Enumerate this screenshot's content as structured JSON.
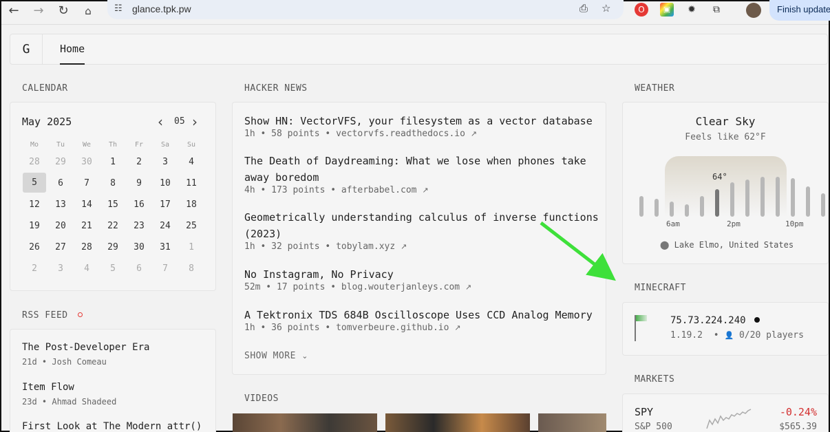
{
  "browser": {
    "url": "glance.tpk.pw",
    "finish_update_label": "Finish update"
  },
  "header": {
    "logo": "G",
    "home_tab": "Home"
  },
  "calendar": {
    "section_title": "CALENDAR",
    "month_label": "May 2025",
    "month_number": "05",
    "days_of_week": [
      "Mo",
      "Tu",
      "We",
      "Th",
      "Fr",
      "Sa",
      "Su"
    ],
    "weeks": [
      [
        "28",
        "29",
        "30",
        "1",
        "2",
        "3",
        "4"
      ],
      [
        "5",
        "6",
        "7",
        "8",
        "9",
        "10",
        "11"
      ],
      [
        "12",
        "13",
        "14",
        "15",
        "16",
        "17",
        "18"
      ],
      [
        "19",
        "20",
        "21",
        "22",
        "23",
        "24",
        "25"
      ],
      [
        "26",
        "27",
        "28",
        "29",
        "30",
        "31",
        "1"
      ],
      [
        "2",
        "3",
        "4",
        "5",
        "6",
        "7",
        "8"
      ]
    ],
    "today": "5"
  },
  "rss": {
    "section_title": "RSS FEED",
    "items": [
      {
        "title": "The Post-Developer Era",
        "age": "21d",
        "author": "Josh Comeau"
      },
      {
        "title": "Item Flow",
        "age": "23d",
        "author": "Ahmad Shadeed"
      },
      {
        "title": "First Look at The Modern attr()",
        "age": "",
        "author": ""
      }
    ]
  },
  "hacker_news": {
    "section_title": "HACKER NEWS",
    "items": [
      {
        "title": "Show HN: VectorVFS, your filesystem as a vector database",
        "age": "1h",
        "points": "58 points",
        "domain": "vectorvfs.readthedocs.io"
      },
      {
        "title": "The Death of Daydreaming: What we lose when phones take away boredom",
        "age": "4h",
        "points": "173 points",
        "domain": "afterbabel.com"
      },
      {
        "title": "Geometrically understanding calculus of inverse functions (2023)",
        "age": "1h",
        "points": "32 points",
        "domain": "tobylam.xyz"
      },
      {
        "title": "No Instagram, No Privacy",
        "age": "52m",
        "points": "17 points",
        "domain": "blog.wouterjanleys.com"
      },
      {
        "title": "A Tektronix TDS 684B Oscilloscope Uses CCD Analog Memory",
        "age": "1h",
        "points": "36 points",
        "domain": "tomverbeure.github.io"
      }
    ],
    "show_more": "SHOW MORE"
  },
  "videos": {
    "section_title": "VIDEOS"
  },
  "weather": {
    "section_title": "WEATHER",
    "condition": "Clear Sky",
    "feels_like": "Feels like 62°F",
    "current_temp": "64°",
    "hour_labels": [
      "6am",
      "2pm",
      "10pm"
    ],
    "location": "Lake Elmo, United States"
  },
  "minecraft": {
    "section_title": "MINECRAFT",
    "address": "75.73.224.240",
    "version": "1.19.2",
    "players": "0/20 players"
  },
  "markets": {
    "section_title": "MARKETS",
    "symbol": "SPY",
    "name": "S&P 500",
    "change": "-0.24%",
    "price": "$565.39",
    "change_color": "#d32f2f"
  }
}
